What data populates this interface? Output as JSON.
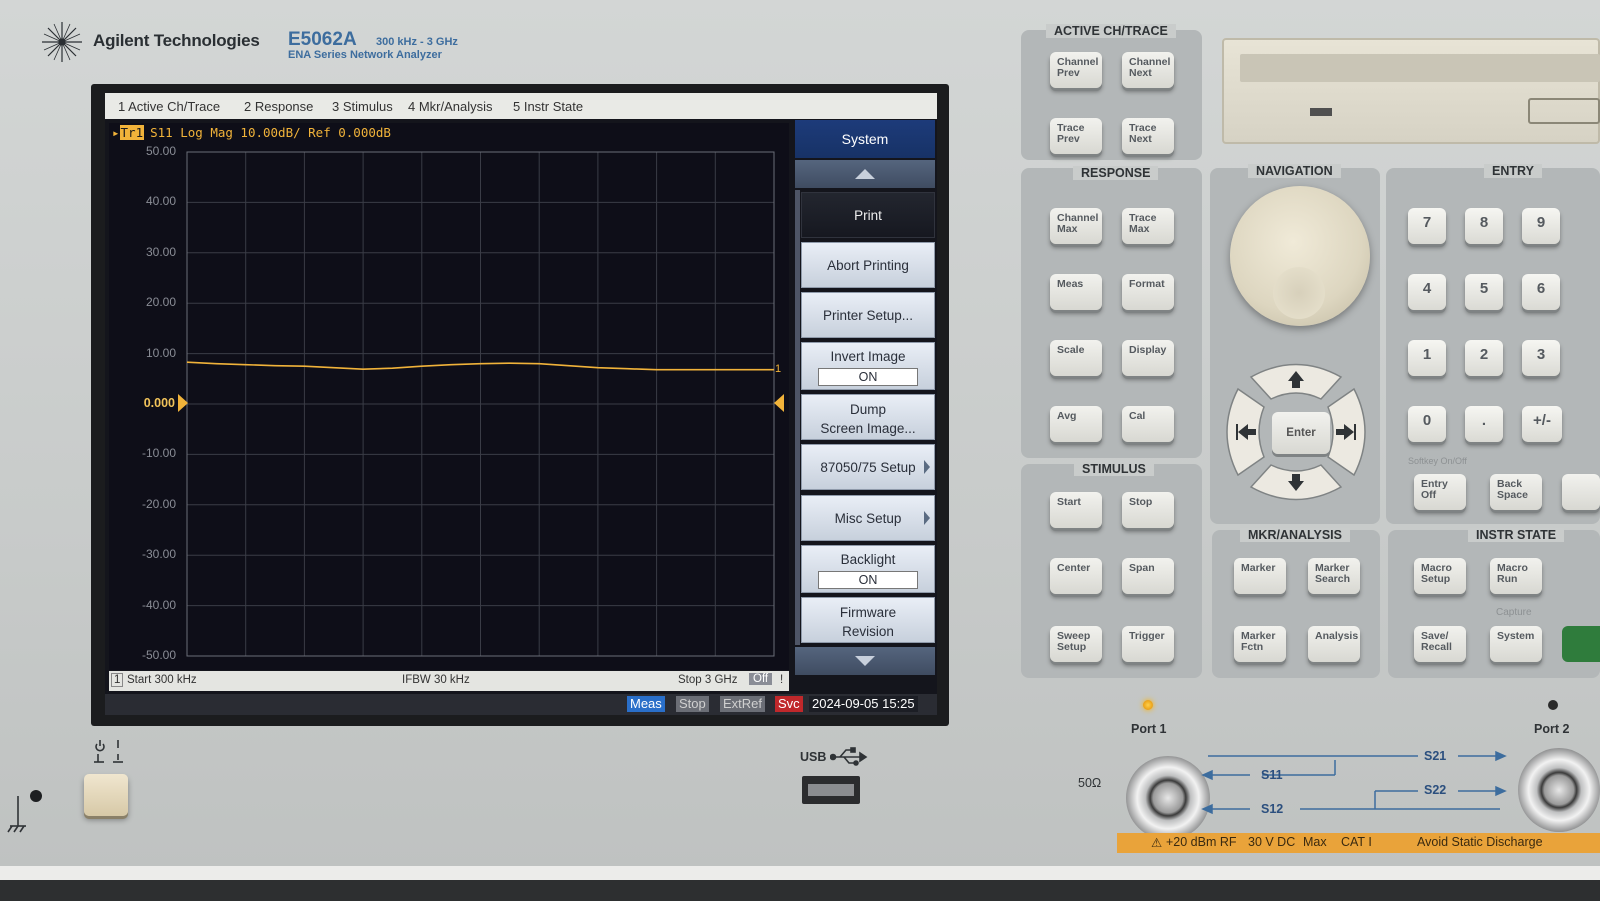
{
  "brand": {
    "company": "Agilent Technologies",
    "model": "E5062A",
    "freq_range": "300 kHz - 3 GHz",
    "series": "ENA Series Network Analyzer"
  },
  "menu": [
    "1 Active Ch/Trace",
    "2 Response",
    "3 Stimulus",
    "4 Mkr/Analysis",
    "5 Instr State"
  ],
  "trace": {
    "tag": "Tr1",
    "title": "S11 Log Mag 10.00dB/ Ref 0.000dB",
    "end_marker": "1"
  },
  "chart_data": {
    "type": "line",
    "title": "S11 Log Mag 10.00dB/ Ref 0.000dB",
    "ylim": [
      -50,
      50
    ],
    "y_ticks": [
      "50.00",
      "40.00",
      "30.00",
      "20.00",
      "10.00",
      "0.000",
      "-10.00",
      "-20.00",
      "-30.00",
      "-40.00",
      "-50.00"
    ],
    "grid": true,
    "series": [
      {
        "color": "#f1b33a",
        "x": [
          0.3,
          150,
          300,
          450,
          600,
          750,
          900,
          1050,
          1200,
          1350,
          1500,
          1650,
          1800,
          1950,
          2100,
          2250,
          2400,
          2550,
          2700,
          2850,
          3000
        ],
        "y": [
          8.3,
          8.0,
          7.8,
          7.6,
          7.5,
          7.2,
          6.9,
          7.1,
          7.5,
          7.8,
          8.0,
          8.1,
          8.0,
          7.6,
          7.2,
          7.0,
          6.8,
          6.8,
          6.8,
          6.8,
          6.8
        ]
      }
    ]
  },
  "stimulus": {
    "channel": "1",
    "start": "Start 300 kHz",
    "ifbw": "IFBW 30 kHz",
    "stop": "Stop 3 GHz",
    "off": "Off",
    "bar": "!"
  },
  "status": {
    "meas": "Meas",
    "stop": "Stop",
    "extref": "ExtRef",
    "svc": "Svc",
    "datetime": "2024-09-05 15:25"
  },
  "softkeys": {
    "title": "System",
    "print": "Print",
    "abort": "Abort Printing",
    "printer_setup": "Printer Setup...",
    "invert_label": "Invert Image",
    "invert_value": "ON",
    "dump_line1": "Dump",
    "dump_line2": "Screen Image...",
    "setup_8705": "87050/75 Setup",
    "misc": "Misc Setup",
    "backlight_label": "Backlight",
    "backlight_value": "ON",
    "firmware_line1": "Firmware",
    "firmware_line2": "Revision"
  },
  "panel": {
    "active_label": "ACTIVE CH/TRACE",
    "response_label": "RESPONSE",
    "navigation_label": "NAVIGATION",
    "entry_label": "ENTRY",
    "stimulus_label": "STIMULUS",
    "mkr_label": "MKR/ANALYSIS",
    "instr_label": "INSTR STATE",
    "active_keys": [
      [
        "Channel",
        "Prev"
      ],
      [
        "Channel",
        "Next"
      ],
      [
        "Trace",
        "Prev"
      ],
      [
        "Trace",
        "Next"
      ]
    ],
    "response_keys": [
      [
        "Channel",
        "Max"
      ],
      [
        "Trace",
        "Max"
      ],
      [
        "Meas",
        ""
      ],
      [
        "Format",
        ""
      ],
      [
        "Scale",
        ""
      ],
      [
        "Display",
        ""
      ],
      [
        "Avg",
        ""
      ],
      [
        "Cal",
        ""
      ]
    ],
    "stimulus_keys": [
      [
        "Start",
        ""
      ],
      [
        "Stop",
        ""
      ],
      [
        "Center",
        ""
      ],
      [
        "Span",
        ""
      ],
      [
        "Sweep",
        "Setup"
      ],
      [
        "Trigger",
        ""
      ]
    ],
    "mkr_keys": [
      [
        "Marker",
        ""
      ],
      [
        "Marker",
        "Search"
      ],
      [
        "Marker",
        "Fctn"
      ],
      [
        "Analysis",
        ""
      ]
    ],
    "instr_keys": [
      [
        "Macro",
        "Setup"
      ],
      [
        "Macro",
        "Run"
      ],
      [
        "Save/",
        "Recall"
      ],
      [
        "System",
        ""
      ]
    ],
    "capture": "Capture",
    "softkey_onoff": "Softkey On/Off",
    "entry_keys": [
      "7",
      "8",
      "9",
      "4",
      "5",
      "6",
      "1",
      "2",
      "3",
      "0",
      ".",
      "+/-"
    ],
    "entry_off": [
      "Entry",
      "Off"
    ],
    "back_space": [
      "Back",
      "Space"
    ],
    "enter": "Enter",
    "port1": "Port 1",
    "port2": "Port 2",
    "ohm": "50Ω",
    "usb": "USB",
    "s21": "S21",
    "s11": "S11",
    "s22": "S22",
    "s12": "S12",
    "warning": {
      "rf": "+20 dBm RF",
      "dc": "30 V DC",
      "max": "Max",
      "cat": "CAT I",
      "static": "Avoid Static Discharge"
    }
  }
}
